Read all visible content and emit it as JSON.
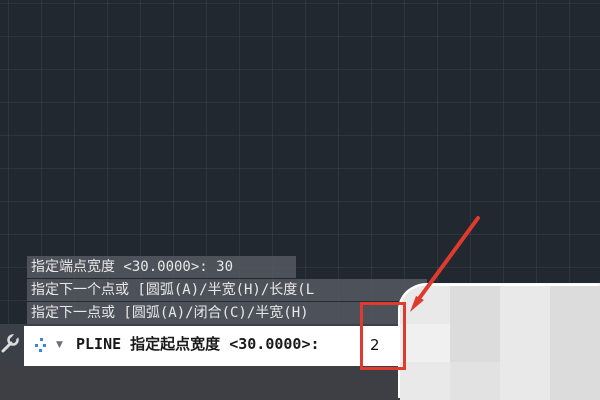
{
  "history": [
    "指定端点宽度 <30.0000>: 30",
    "指定下一个点或 [圆弧(A)/半宽(H)/长度(L",
    "指定下一点或 [圆弧(A)/闭合(C)/半宽(H)"
  ],
  "command": {
    "prompt": "PLINE 指定起点宽度 <30.0000>:",
    "input_value": "2"
  },
  "icons": {
    "customize": "wrench-icon",
    "recent": "dots-icon",
    "dropdown": "chevron-down-icon"
  },
  "colors": {
    "canvas": "#212830",
    "highlight": "#e03a2e"
  }
}
